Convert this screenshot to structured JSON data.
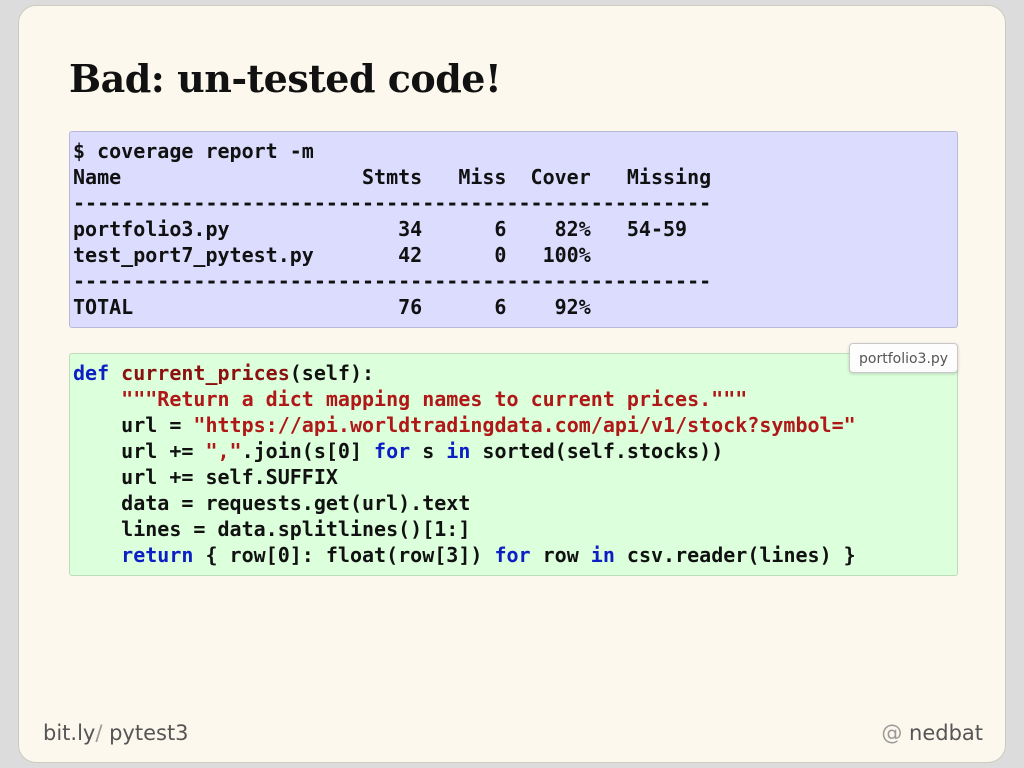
{
  "slide": {
    "title": "Bad: un-tested code!"
  },
  "terminal": {
    "prompt": "$ coverage report -m",
    "header": "Name                    Stmts   Miss  Cover   Missing",
    "separator": "-----------------------------------------------------",
    "rows": [
      "portfolio3.py              34      6    82%   54-59",
      "test_port7_pytest.py       42      0   100%"
    ],
    "separator2": "-----------------------------------------------------",
    "total": "TOTAL                      76      6    92%"
  },
  "code": {
    "filename": "portfolio3.py",
    "l1": {
      "def": "def",
      "name": "current_prices",
      "rest": "(self):"
    },
    "l2": {
      "indent": "    ",
      "str": "\"\"\"Return a dict mapping names to current prices.\"\"\""
    },
    "l3": {
      "pre": "    url = ",
      "str": "\"https://api.worldtradingdata.com/api/v1/stock?symbol=\""
    },
    "l4": {
      "pre": "    url += ",
      "str": "\",\"",
      "mid": ".join(s[0] ",
      "kw1": "for",
      "mid2": " s ",
      "kw2": "in",
      "post": " sorted(self.stocks))"
    },
    "l5": {
      "text": "    url += self.SUFFIX"
    },
    "l6": {
      "text": "    data = requests.get(url).text"
    },
    "l7": {
      "text": "    lines = data.splitlines()[1:]"
    },
    "l8": {
      "indent": "    ",
      "kw1": "return",
      "mid": " { row[0]: float(row[3]) ",
      "kw2": "for",
      "mid2": " row ",
      "kw3": "in",
      "post": " csv.reader(lines) }"
    }
  },
  "footer": {
    "left_prefix": "bit.ly",
    "left_slash": "/",
    "left_suffix": " pytest3",
    "right_at": "@",
    "right_handle": " nedbat"
  }
}
